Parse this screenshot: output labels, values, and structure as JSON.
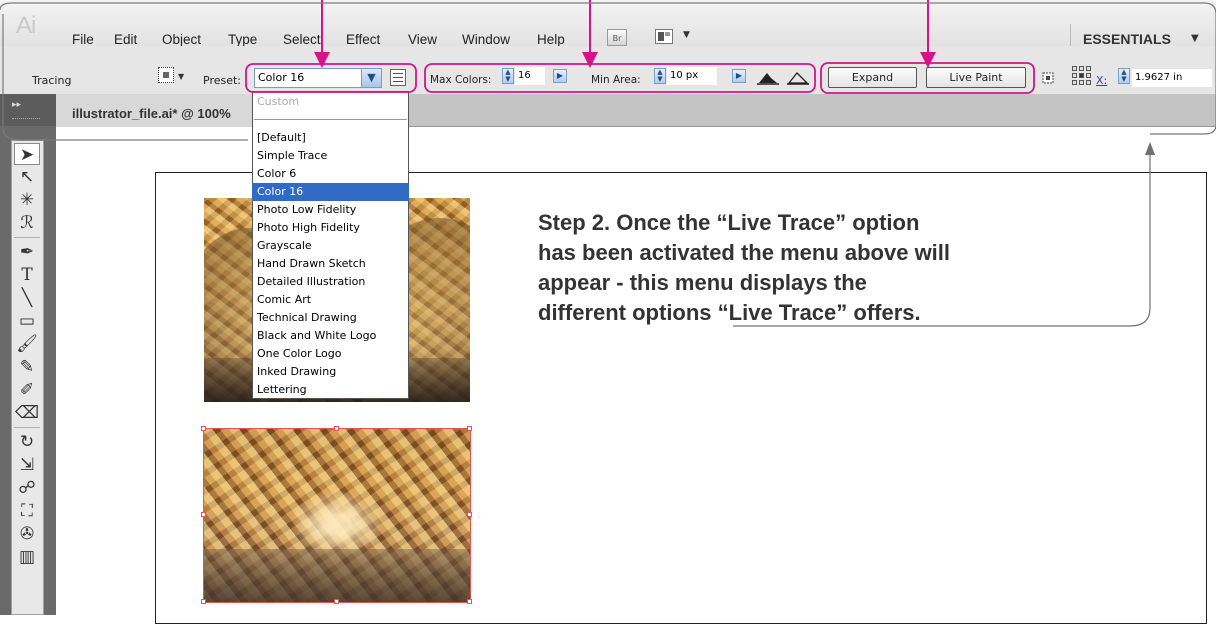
{
  "app": {
    "logo": "Ai",
    "menus": [
      "File",
      "Edit",
      "Object",
      "Type",
      "Select",
      "Effect",
      "View",
      "Window",
      "Help"
    ],
    "bridge_button": "Br",
    "workspace": "ESSENTIALS"
  },
  "control_panel": {
    "mode_label": "Tracing",
    "preset_label": "Preset:",
    "preset_value": "Color 16",
    "max_colors_label": "Max Colors:",
    "max_colors_value": "16",
    "min_area_label": "Min Area:",
    "min_area_value": "10 px",
    "expand_button": "Expand",
    "live_paint_button": "Live Paint",
    "x_label": "X:",
    "x_value": "1.9627 in"
  },
  "document": {
    "tab_title": "illustrator_file.ai* @ 100%"
  },
  "preset_dropdown": {
    "options": [
      "Custom",
      "[Default]",
      "Simple Trace",
      "Color 6",
      "Color 16",
      "Photo Low Fidelity",
      "Photo High Fidelity",
      "Grayscale",
      "Hand Drawn Sketch",
      "Detailed Illustration",
      "Comic Art",
      "Technical Drawing",
      "Black and White Logo",
      "One Color Logo",
      "Inked Drawing",
      "Lettering"
    ],
    "selected": "Color 16",
    "disabled": "Custom"
  },
  "tools": [
    "selection-tool",
    "direct-selection-tool",
    "magic-wand-tool",
    "lasso-tool",
    "pen-tool",
    "type-tool",
    "line-segment-tool",
    "rectangle-tool",
    "paintbrush-tool",
    "pencil-tool",
    "blob-brush-tool",
    "eraser-tool",
    "rotate-tool",
    "scale-tool",
    "warp-tool",
    "free-transform-tool",
    "symbol-sprayer-tool",
    "column-graph-tool"
  ],
  "annotation": {
    "step_text": "Step 2. Once the “Live Trace” option has been activated the menu above will appear - this menu displays the different options “Live Trace” offers.",
    "highlight_color": "#d6138a",
    "callout_color": "#707070"
  },
  "colors": {
    "selection_blue": "#316ac5",
    "selection_bounds": "#e25555",
    "toolbar_dark": "#6a6a6a"
  }
}
